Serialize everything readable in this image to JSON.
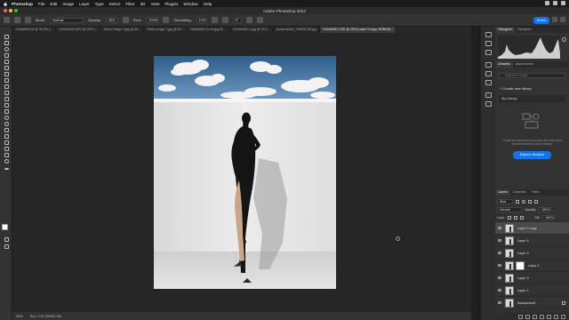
{
  "menubar": {
    "app": "Photoshop",
    "items": [
      "File",
      "Edit",
      "Image",
      "Layer",
      "Type",
      "Select",
      "Filter",
      "3D",
      "View",
      "Plugins",
      "Window",
      "Help"
    ]
  },
  "window": {
    "title": "Adobe Photoshop 2022"
  },
  "options": {
    "mode_label": "Mode:",
    "mode_value": "Normal",
    "opacity_label": "Opacity:",
    "opacity_value": "40%",
    "flow_label": "Flow:",
    "flow_value": "100%",
    "smoothing_label": "Smoothing:",
    "smoothing_value": "10%",
    "angle_value": "0°",
    "share_label": "Share"
  },
  "tabs": [
    "1HAA6441.tif @ 33.3% (...",
    "1HAA6450.CR2 @ 25% (...",
    "Stock Image 2.jpg @ 50...",
    "Stock Image 1.jpg @ 50...",
    "1HAA6461-2-rev.jpg @ ...",
    "1HAA6461-1.jpg @ 33.3...",
    "shutterstock_749836756.jpg",
    "1HAA6481.CR2 @ 25% (Layer 5 copy, RGB/16) *"
  ],
  "status": {
    "zoom": "25%",
    "doc": "Doc: 176.7M/953.9M"
  },
  "panels": {
    "top_tabs": [
      "Histogram",
      "Navigator"
    ],
    "mid_tabs": [
      "Libraries",
      "Adjustments"
    ],
    "library_search_placeholder": "Search in Stock",
    "create_library": "+ Create new library",
    "my_library": "My Library",
    "library_text": "Create and upload all your stock and save your favourite assets to your Libraries",
    "explore_button": "Explore libraries",
    "layers_tabs": [
      "Layers",
      "Channels",
      "Paths"
    ],
    "kind_label": "Kind",
    "blend_mode": "Normal",
    "opacity_label": "Opacity:",
    "opacity_value": "100%",
    "lock_label": "Lock:",
    "fill_label": "Fill:",
    "fill_value": "100%",
    "layers": [
      {
        "name": "Layer 5 copy",
        "active": true,
        "mask": false
      },
      {
        "name": "Layer 5",
        "active": false,
        "mask": false
      },
      {
        "name": "Layer 4",
        "active": false,
        "mask": false
      },
      {
        "name": "Layer 2",
        "active": false,
        "mask": true
      },
      {
        "name": "Layer 3",
        "active": false,
        "mask": false
      },
      {
        "name": "Layer 1",
        "active": false,
        "mask": false
      },
      {
        "name": "Background",
        "active": false,
        "mask": false
      }
    ]
  }
}
